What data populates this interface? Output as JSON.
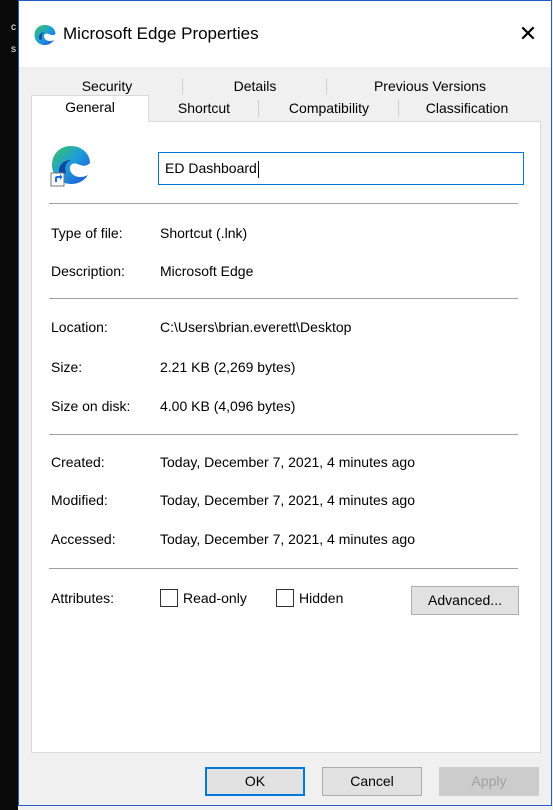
{
  "window": {
    "title": "Microsoft Edge Properties",
    "close_glyph": "✕"
  },
  "background_crumbs": [
    "c",
    "s"
  ],
  "tabs": {
    "back_row": [
      {
        "label": "Security"
      },
      {
        "label": "Details"
      },
      {
        "label": "Previous Versions"
      }
    ],
    "front_row": [
      {
        "label": "General",
        "active": true
      },
      {
        "label": "Shortcut"
      },
      {
        "label": "Compatibility"
      },
      {
        "label": "Classification"
      }
    ]
  },
  "general": {
    "icon": "microsoft-edge-shortcut-icon",
    "name_value": "ED Dashboard",
    "type_of_file": {
      "label": "Type of file:",
      "value": "Shortcut (.lnk)"
    },
    "description": {
      "label": "Description:",
      "value": "Microsoft Edge"
    },
    "location": {
      "label": "Location:",
      "value": "C:\\Users\\brian.everett\\Desktop"
    },
    "size": {
      "label": "Size:",
      "value": "2.21 KB (2,269 bytes)"
    },
    "size_on_disk": {
      "label": "Size on disk:",
      "value": "4.00 KB (4,096 bytes)"
    },
    "created": {
      "label": "Created:",
      "value": "Today, December 7, 2021, 4 minutes ago"
    },
    "modified": {
      "label": "Modified:",
      "value": "Today, December 7, 2021, 4 minutes ago"
    },
    "accessed": {
      "label": "Accessed:",
      "value": "Today, December 7, 2021, 4 minutes ago"
    },
    "attributes": {
      "label": "Attributes:",
      "read_only_label": "Read-only",
      "read_only_checked": false,
      "hidden_label": "Hidden",
      "hidden_checked": false,
      "advanced_label": "Advanced..."
    }
  },
  "buttons": {
    "ok": "OK",
    "cancel": "Cancel",
    "apply": "Apply",
    "apply_enabled": false
  },
  "colors": {
    "accent": "#0078d7",
    "edge_blue": "#1e6fd9",
    "edge_green": "#3ec35a"
  }
}
